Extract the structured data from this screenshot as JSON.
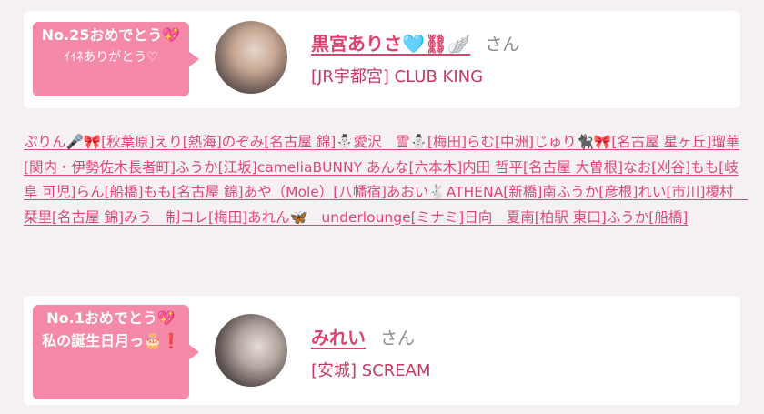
{
  "entries": [
    {
      "badge_line1": "No.25おめでとう💖",
      "badge_line2": "ｲｲﾈありがとう♡",
      "name": "黒宮ありさ🩵⛓🪽",
      "honorific": "さん",
      "city": "[JR宇都宮]",
      "shop": "CLUB KING"
    },
    {
      "badge_line1": "No.1おめでとう💖",
      "badge_line2": "私の誕生日月っ🎂❗️",
      "name": "みれい",
      "honorific": "さん",
      "city": "[安城]",
      "shop": "SCREAM"
    }
  ],
  "voter_text": "ぷりん🎤🎀[秋葉原]えり[熱海]のぞみ[名古屋 錦]⛄愛沢　雪⛄[梅田]らむ[中洲]じゅり🐈‍⬛🎀[名古屋 星ヶ丘]瑠華[関内・伊勢佐木長者町]ふうか[江坂]cameliaBUNNY あんな[六本木]内田 哲平[名古屋 大曽根]なお[刈谷]もも[岐阜 可児]らん[船橋]もも[名古屋 錦]あや（Mole）[八幡宿]あおい🐇ATHENA[新橋]南ふうか[彦根]れい[市川]榎村　栞里[名古屋 錦]みう　制コレ[梅田]あれん🦋　underlounge[ミナミ]日向　夏南[柏駅 東口]ふうか[船橋]"
}
